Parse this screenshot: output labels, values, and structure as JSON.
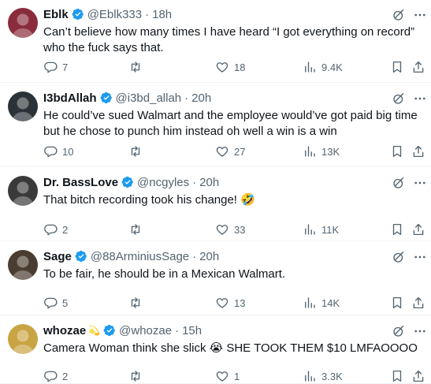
{
  "tweets": [
    {
      "name": "Eblk",
      "handle": "@Eblk333",
      "time": "18h",
      "text": "Can’t believe how many times I have heard “I got everything on record” who the fuck says that.",
      "replies": "7",
      "retweets": "",
      "likes": "18",
      "views": "9.4K",
      "avatar_color": "#8a2c3c"
    },
    {
      "name": "I3bdAllah",
      "handle": "@i3bd_allah",
      "time": "20h",
      "text": "He could’ve sued Walmart and the employee would’ve got paid big time but he chose to punch him instead oh well a win is a win",
      "replies": "10",
      "retweets": "",
      "likes": "27",
      "views": "13K",
      "avatar_color": "#2c3338"
    },
    {
      "name": "Dr. BassLove",
      "handle": "@ncgyles",
      "time": "20h",
      "text": "That bitch recording took his change! 🤣",
      "replies": "2",
      "retweets": "",
      "likes": "33",
      "views": "11K",
      "avatar_color": "#3a3a3a"
    },
    {
      "name": "Sage",
      "handle": "@88ArminiusSage",
      "time": "20h",
      "text": "To be fair, he should be in a Mexican Walmart.",
      "replies": "5",
      "retweets": "",
      "likes": "13",
      "views": "14K",
      "avatar_color": "#4a3c30"
    },
    {
      "name": "whozae",
      "name_emoji": "💫",
      "handle": "@whozae",
      "time": "15h",
      "text": "Camera Woman think she slick 😭 SHE TOOK THEM $10 LMFAOOOO",
      "replies": "2",
      "retweets": "",
      "likes": "1",
      "views": "3.3K",
      "avatar_color": "#c9a443"
    }
  ],
  "icons": {
    "verified": "verified-badge-icon",
    "grok": "grok-icon",
    "more": "more-icon",
    "reply": "reply-icon",
    "retweet": "retweet-icon",
    "like": "heart-icon",
    "views": "views-icon",
    "bookmark": "bookmark-icon",
    "share": "share-icon"
  },
  "colors": {
    "verified": "#1d9bf0",
    "secondary_text": "#536471",
    "divider": "#eff3f4"
  }
}
